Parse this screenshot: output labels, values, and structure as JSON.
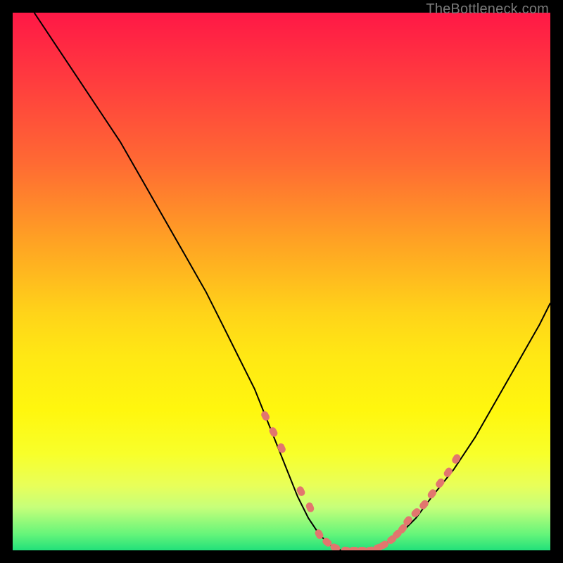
{
  "watermark": "TheBottleneck.com",
  "colors": {
    "background": "#000000",
    "curve": "#000000",
    "dots": "#e2766e",
    "gradient_top": "#ff1846",
    "gradient_bottom": "#22e07a"
  },
  "chart_data": {
    "type": "line",
    "title": "",
    "xlabel": "",
    "ylabel": "",
    "xlim": [
      0,
      100
    ],
    "ylim": [
      0,
      100
    ],
    "grid": false,
    "series": [
      {
        "name": "bottleneck-curve",
        "x": [
          4,
          8,
          12,
          16,
          20,
          24,
          28,
          32,
          36,
          39,
          42,
          45,
          47,
          49,
          51,
          53,
          55,
          57,
          59,
          61,
          63,
          65,
          67,
          69,
          72,
          75,
          78,
          82,
          86,
          90,
          94,
          98,
          100
        ],
        "y": [
          100,
          94,
          88,
          82,
          76,
          69,
          62,
          55,
          48,
          42,
          36,
          30,
          25,
          20,
          15,
          10,
          6,
          3,
          1,
          0,
          0,
          0,
          0,
          1,
          3,
          6,
          10,
          15,
          21,
          28,
          35,
          42,
          46
        ]
      }
    ],
    "highlight_points": {
      "name": "flat-region-dots",
      "x": [
        47,
        48.5,
        50,
        53.6,
        55.3,
        57,
        58.5,
        60,
        62,
        63.5,
        65,
        66.5,
        68,
        69,
        70.5,
        71.5,
        72.5,
        73.5,
        75,
        76.5,
        78,
        79.5,
        81,
        82.5
      ],
      "y": [
        25,
        22,
        19,
        11,
        8,
        3,
        1.5,
        0.5,
        0,
        0,
        0,
        0,
        0.5,
        1,
        2,
        3,
        4,
        5.5,
        7,
        8.5,
        10.5,
        12.5,
        14.5,
        17
      ]
    }
  }
}
